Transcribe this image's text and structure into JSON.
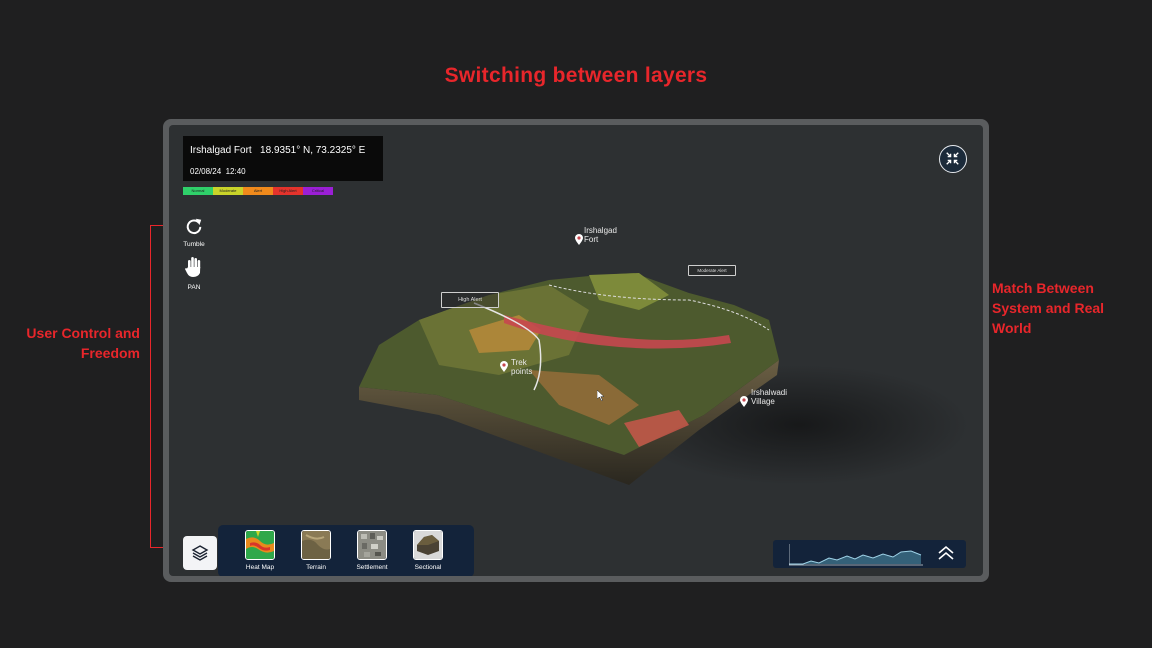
{
  "page_title": "Switching between layers",
  "annotations": {
    "left": "User Control and Freedom",
    "right": "Match Between System and Real World"
  },
  "location": {
    "name": "Irshalgad Fort",
    "coords": "18.9351° N, 73.2325° E",
    "date": "02/08/24",
    "time": "12:40"
  },
  "legend": [
    {
      "label": "Normal",
      "color": "#2fd06a"
    },
    {
      "label": "Moderate",
      "color": "#c9d42a"
    },
    {
      "label": "Alert",
      "color": "#f08a1c"
    },
    {
      "label": "High Alert",
      "color": "#e4332c"
    },
    {
      "label": "Critical",
      "color": "#9b1fd6"
    }
  ],
  "tools": {
    "tumble": {
      "label": "Tumble",
      "icon": "rotate-icon"
    },
    "pan": {
      "label": "PAN",
      "icon": "hand-icon"
    }
  },
  "map_labels": {
    "fort": [
      "Irshalgad",
      "Fort"
    ],
    "trek": [
      "Trek",
      "points"
    ],
    "village": [
      "Irshalwadi",
      "Village"
    ],
    "high_alert": "High Alert",
    "moderate_alert": "Moderate Alert"
  },
  "layers": [
    {
      "label": "Heat Map",
      "icon": "heatmap-thumbnail"
    },
    {
      "label": "Terrain",
      "icon": "terrain-thumbnail"
    },
    {
      "label": "Settlement",
      "icon": "settlement-thumbnail"
    },
    {
      "label": "Sectional",
      "icon": "sectional-thumbnail"
    }
  ],
  "colors": {
    "accent": "#e8262b",
    "panel": "#13233a",
    "screen": "#2d3032"
  }
}
